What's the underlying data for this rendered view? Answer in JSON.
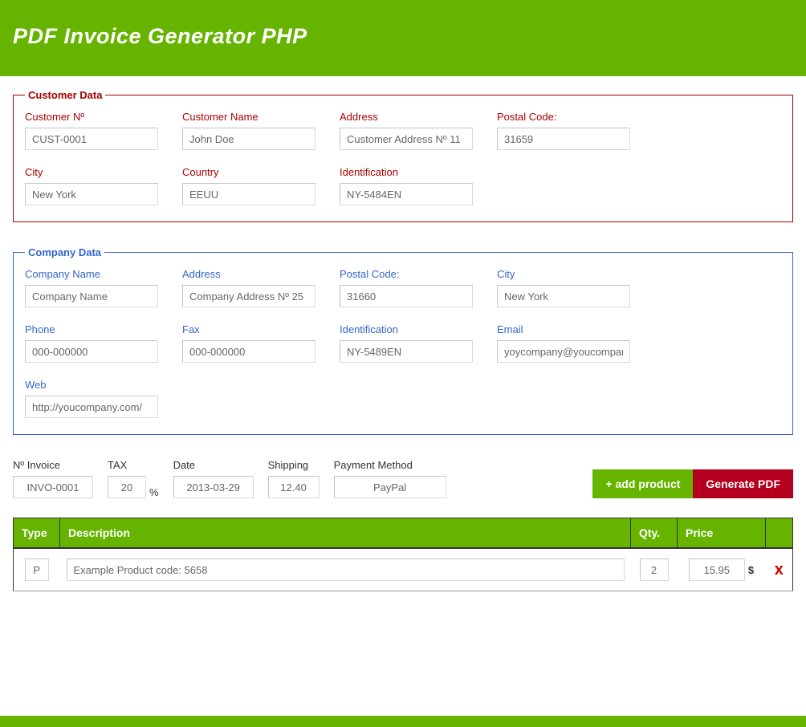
{
  "header": {
    "title": "PDF Invoice Generator PHP"
  },
  "customer": {
    "legend": "Customer Data",
    "number_label": "Customer Nº",
    "number": "CUST-0001",
    "name_label": "Customer Name",
    "name": "John Doe",
    "address_label": "Address",
    "address": "Customer Address Nº 11",
    "postal_label": "Postal Code:",
    "postal": "31659",
    "city_label": "City",
    "city": "New York",
    "country_label": "Country",
    "country": "EEUU",
    "ident_label": "Identification",
    "ident": "NY-5484EN"
  },
  "company": {
    "legend": "Company Data",
    "name_label": "Company Name",
    "name": "Company Name",
    "address_label": "Address",
    "address": "Company Address Nº 25",
    "postal_label": "Postal Code:",
    "postal": "31660",
    "city_label": "City",
    "city": "New York",
    "phone_label": "Phone",
    "phone": "000-000000",
    "fax_label": "Fax",
    "fax": "000-000000",
    "ident_label": "Identification",
    "ident": "NY-5489EN",
    "email_label": "Email",
    "email": "yoycompany@youcompany",
    "web_label": "Web",
    "web": "http://youcompany.com/"
  },
  "meta": {
    "invoice_label": "Nº Invoice",
    "invoice": "INVO-0001",
    "tax_label": "TAX",
    "tax": "20",
    "tax_suffix": "%",
    "date_label": "Date",
    "date": "2013-03-29",
    "shipping_label": "Shipping",
    "shipping": "12.40",
    "payment_label": "Payment Method",
    "payment": "PayPal"
  },
  "buttons": {
    "add_product": "+ add product",
    "generate": "Generate PDF"
  },
  "table": {
    "headers": {
      "type": "Type",
      "desc": "Description",
      "qty": "Qty.",
      "price": "Price"
    },
    "row": {
      "type": "P",
      "desc": "Example Product code: 5658",
      "qty": "2",
      "price": "15.95",
      "currency": "$",
      "delete": "x"
    }
  }
}
